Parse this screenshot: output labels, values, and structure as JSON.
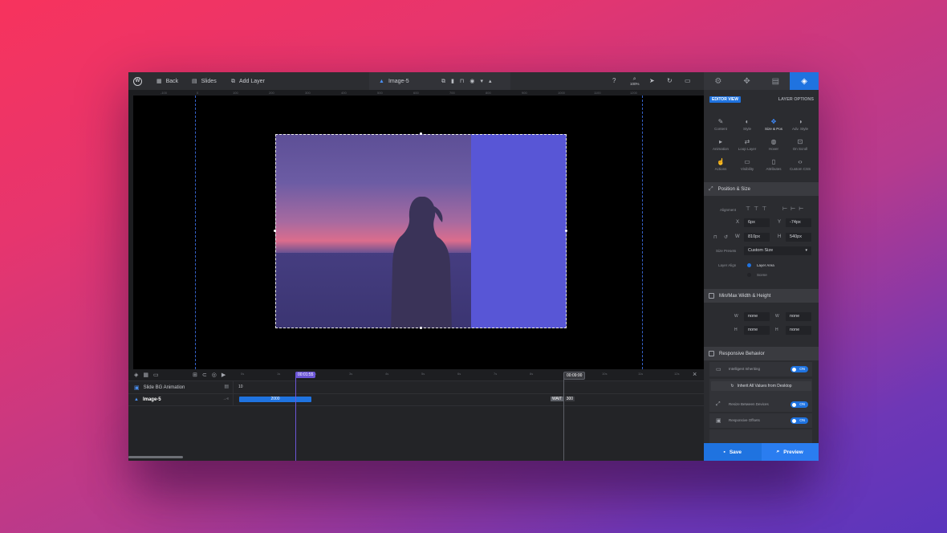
{
  "topbar": {
    "back_label": "Back",
    "slides_label": "Slides",
    "add_layer_label": "Add Layer",
    "layer_name": "Image-5",
    "zoom": "100%"
  },
  "right_panel": {
    "editor_view_label": "EDITOR VIEW",
    "layer_options_label": "LAYER OPTIONS",
    "grid": [
      {
        "label": "Content",
        "icon": "pen-icon"
      },
      {
        "label": "Style",
        "icon": "palette-icon"
      },
      {
        "label": "Size & Pos",
        "icon": "move-icon"
      },
      {
        "label": "Adv. Style",
        "icon": "contrast-icon"
      },
      {
        "label": "Animation",
        "icon": "play-icon"
      },
      {
        "label": "Loop Layer",
        "icon": "loop-icon"
      },
      {
        "label": "Hover",
        "icon": "mouse-icon"
      },
      {
        "label": "On Scroll",
        "icon": "scroll-icon"
      },
      {
        "label": "Actions",
        "icon": "hand-icon"
      },
      {
        "label": "Visibility",
        "icon": "visibility-icon"
      },
      {
        "label": "Attributes",
        "icon": "file-icon"
      },
      {
        "label": "Custom CSS",
        "icon": "code-icon"
      }
    ],
    "position_size": {
      "title": "Position & Size",
      "alignment_label": "Alignment",
      "x_label": "X",
      "x_value": "6px",
      "y_label": "Y",
      "y_value": "-74px",
      "w_label": "W",
      "w_value": "810px",
      "h_label": "H",
      "h_value": "540px",
      "size_presets_label": "Size Presets",
      "size_presets_value": "Custom Size",
      "layer_align_label": "Layer Align",
      "layer_area_label": "Layer Area",
      "scene_label": "Scene"
    },
    "minmax": {
      "title": "Min/Max Width & Height",
      "min_w": "none",
      "max_w": "none",
      "min_h": "none",
      "max_h": "none"
    },
    "responsive": {
      "title": "Responsive Behavior",
      "intelligent_inheriting": "Intelligent Inheriting",
      "inherit_all": "Inherit All Values from Desktop",
      "resize_between": "Resize Between Devices",
      "responsive_offsets": "Responsive Offsets",
      "on_label": "ON"
    },
    "save_label": "Save",
    "preview_label": "Preview"
  },
  "timeline": {
    "ticks": [
      "0s",
      "1s",
      "2s",
      "3s",
      "4s",
      "5s",
      "6s",
      "7s",
      "8s",
      "9s",
      "10s",
      "11s",
      "12s"
    ],
    "playhead_time": "00:01:55",
    "end_time": "00:09:00",
    "rows": [
      {
        "name": "Slide BG Animation",
        "value": "10"
      },
      {
        "name": "Image-5",
        "bar_value": "2000",
        "wait_label": "WAIT",
        "wait_value": "300"
      }
    ]
  },
  "ruler_labels": [
    "-100",
    "0",
    "100",
    "200",
    "300",
    "400",
    "500",
    "600",
    "700",
    "800",
    "900",
    "1000",
    "1100",
    "1200"
  ],
  "colors": {
    "accent": "#1f73e0",
    "layer_blue": "#5856d6",
    "playhead": "#6b55d6"
  }
}
